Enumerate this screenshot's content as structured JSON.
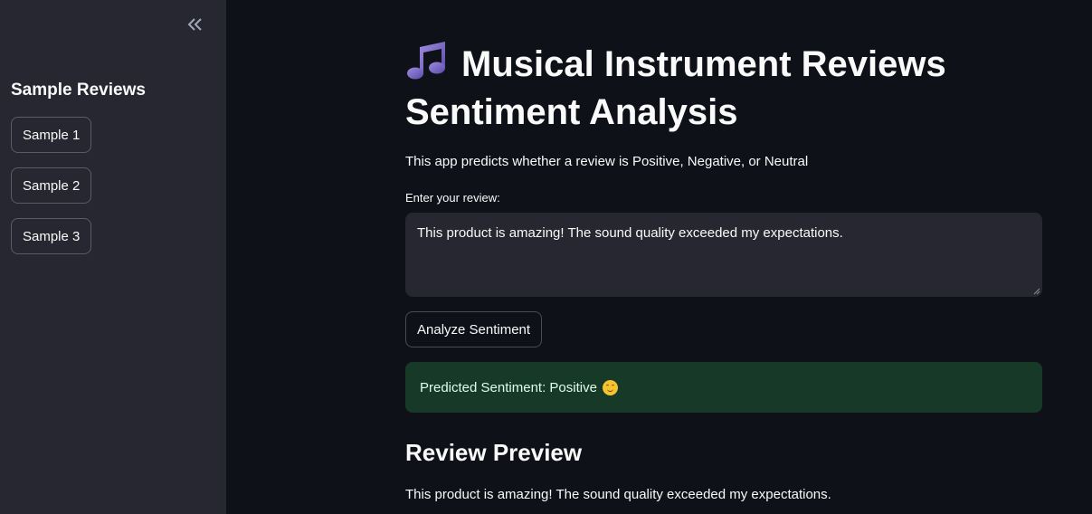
{
  "sidebar": {
    "collapse_icon": "double-chevron-left-icon",
    "title": "Sample Reviews",
    "samples": [
      {
        "label": "Sample 1"
      },
      {
        "label": "Sample 2"
      },
      {
        "label": "Sample 3"
      }
    ]
  },
  "main": {
    "title_icon": "musical-note-icon",
    "title": "Musical Instrument Reviews Sentiment Analysis",
    "subtitle": "This app predicts whether a review is Positive, Negative, or Neutral",
    "review_label": "Enter your review:",
    "review_value": "This product is amazing! The sound quality exceeded my expectations.",
    "analyze_button": "Analyze Sentiment",
    "result": {
      "text": "Predicted Sentiment: Positive",
      "emoji": "smiling-face-icon"
    },
    "preview_heading": "Review Preview",
    "preview_text": "This product is amazing! The sound quality exceeded my expectations."
  },
  "colors": {
    "background": "#0e1117",
    "sidebar": "#262730",
    "success_bg": "#173928",
    "success_text": "#dffde9"
  }
}
